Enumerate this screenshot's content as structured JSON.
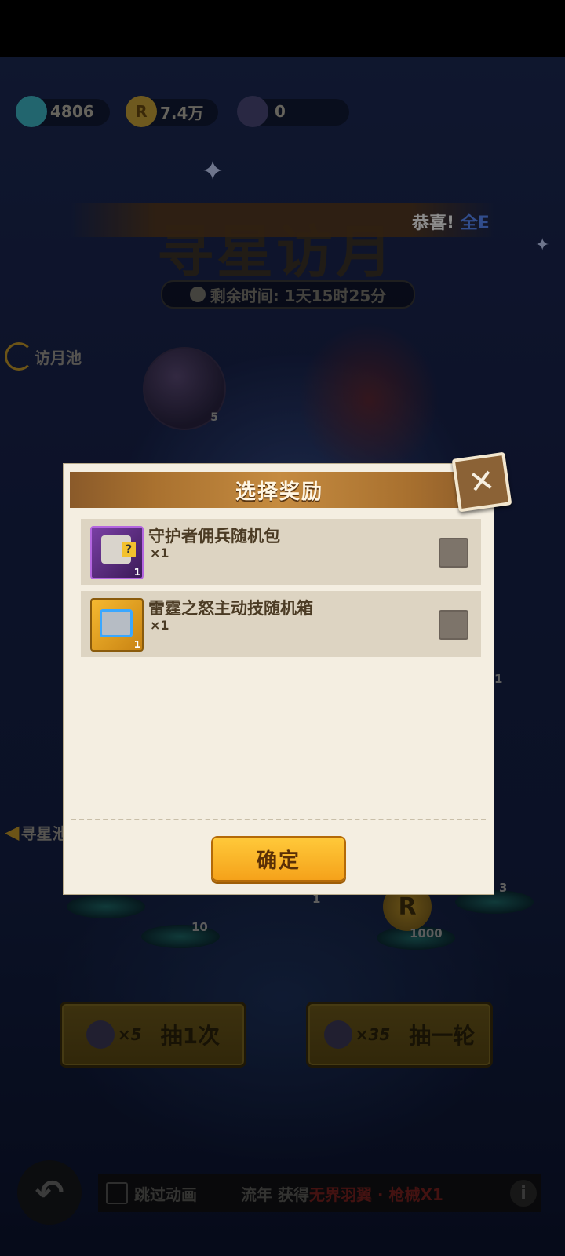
{
  "currencies": [
    {
      "name": "diamond-icon",
      "value": "4806"
    },
    {
      "name": "coin-icon",
      "value": "7.4万"
    },
    {
      "name": "rocket-ticket-icon",
      "value": "0"
    }
  ],
  "event": {
    "title": "寻星访月",
    "timer": "剩余时间: 1天15时25分",
    "marquee_prefix": "恭喜!",
    "marquee_highlight": "全E"
  },
  "side_tabs": [
    "访月池",
    "寻星池"
  ],
  "draw_buttons": [
    {
      "cost": "×5",
      "label": "抽1次"
    },
    {
      "cost": "×35",
      "label": "抽一轮"
    }
  ],
  "reward_counts": [
    "5",
    "1",
    "10",
    "1",
    "1000",
    "3"
  ],
  "bottom_bar": {
    "skip_label": "跳过动画",
    "marquee": "流年",
    "marquee_get": "获得",
    "marquee_red": "无界羽翼 · 枪械X1",
    "info_icon": "info-icon"
  },
  "modal": {
    "title": "选择奖励",
    "items": [
      {
        "name": "守护者佣兵随机包",
        "qty": "×1",
        "count": "1",
        "icon": "mercenary-pack-icon",
        "checked": false
      },
      {
        "name": "雷霆之怒主动技随机箱",
        "qty": "×1",
        "count": "1",
        "icon": "skill-box-icon",
        "checked": false
      }
    ],
    "confirm_label": "确定",
    "close_icon": "close-icon"
  }
}
